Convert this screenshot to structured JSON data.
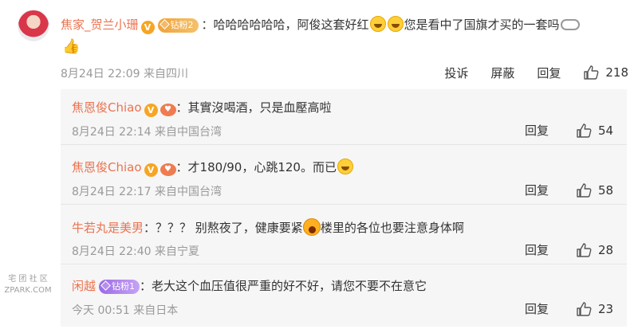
{
  "main_comment": {
    "username": "焦家_贺兰小珊",
    "fan_badge": "钻粉2",
    "text_part1": "哈哈哈哈哈哈，阿俊这套好红",
    "text_part2": "您是看中了国旗才买的一套吗",
    "time": "8月24日 22:09",
    "source": "来自四川",
    "actions": {
      "report": "投诉",
      "block": "屏蔽",
      "reply": "回复"
    },
    "likes": "218"
  },
  "replies": [
    {
      "username": "焦恩俊Chiao",
      "colon": "：",
      "text": "其實沒喝酒，只是血壓高啦",
      "time": "8月24日 22:14",
      "source": "来自中国台湾",
      "reply_label": "回复",
      "likes": "54"
    },
    {
      "username": "焦恩俊Chiao",
      "colon": "：",
      "text": "才180/90，心跳120。而已",
      "time": "8月24日 22:17",
      "source": "来自中国台湾",
      "reply_label": "回复",
      "likes": "58"
    },
    {
      "username": "牛若丸是美男",
      "colon": "：",
      "text_part1": "？？？ 别熬夜了，健康要紧",
      "text_part2": "楼里的各位也要注意身体啊",
      "time": "8月24日 22:40",
      "source": "来自宁夏",
      "reply_label": "回复",
      "likes": "28"
    },
    {
      "username": "闲越",
      "fan_badge": "钻粉1",
      "colon": "：",
      "text": "老大这个血压值很严重的好不好，请您不要不在意它",
      "time": "今天 00:51",
      "source": "来自日本",
      "reply_label": "回复",
      "likes": "23"
    }
  ],
  "watermark": {
    "line1": "宅 团 社 区",
    "line2": "ZPARK.COM"
  },
  "colors": {
    "username": "#eb7350",
    "muted": "#999999",
    "reply_bg": "#f6f6f6"
  }
}
